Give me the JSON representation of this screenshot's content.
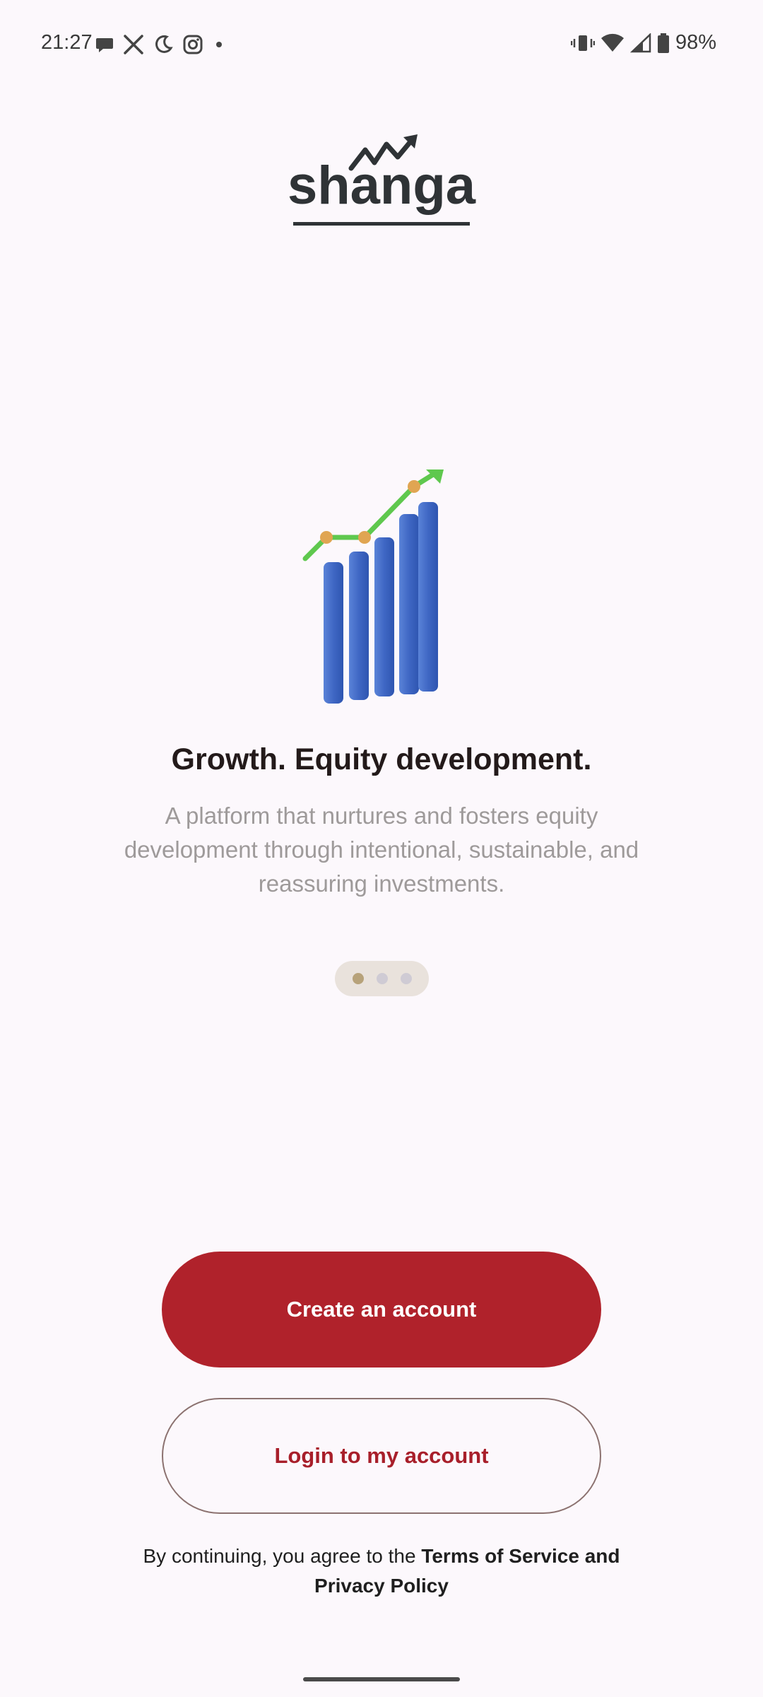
{
  "status_bar": {
    "time": "21:27",
    "battery_percent": "98%",
    "icons_left": [
      "chat-bubble-icon",
      "x-logo-icon",
      "do-not-disturb-moon-icon",
      "instagram-icon",
      "notification-dot-icon"
    ],
    "icons_right": [
      "vibrate-icon",
      "wifi-icon",
      "cell-signal-icon",
      "battery-icon"
    ]
  },
  "brand": {
    "logo_text": "shanga",
    "logo_color": "#2f3336"
  },
  "onboarding": {
    "headline": "Growth. Equity development.",
    "description": "A platform that nurtures and fosters equity development through intentional, sustainable, and reassuring investments.",
    "page_count": 3,
    "current_page": 1,
    "illustration": "growth-chart-illustration"
  },
  "actions": {
    "create_account_label": "Create an account",
    "login_label": "Login to my account"
  },
  "terms": {
    "prefix": "By continuing, you agree to the ",
    "link": "Terms of Service and Privacy Policy"
  },
  "colors": {
    "primary": "#b0222b",
    "background": "#fcf8fc",
    "headline": "#231a1a",
    "description": "#9e9a9a"
  }
}
